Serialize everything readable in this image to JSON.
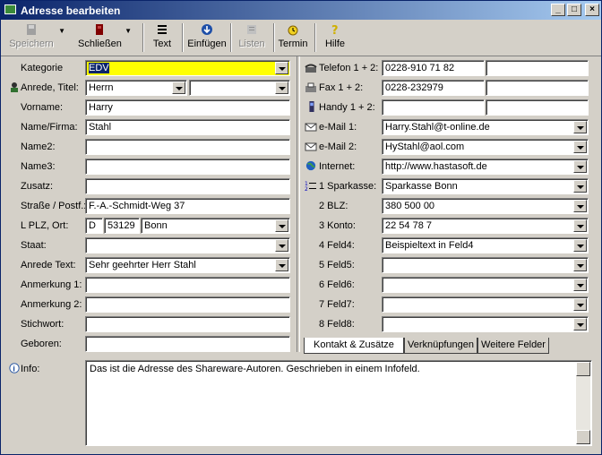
{
  "window": {
    "title": "Adresse bearbeiten",
    "minimize": "_",
    "maximize": "□",
    "close": "×"
  },
  "toolbar": {
    "speichern": "Speichern",
    "schliessen": "Schließen",
    "text": "Text",
    "einfuegen": "Einfügen",
    "listen": "Listen",
    "termin": "Termin",
    "hilfe": "Hilfe"
  },
  "left": {
    "kategorie": {
      "label": "Kategorie",
      "value": "EDV"
    },
    "anrede_titel": {
      "label": "Anrede, Titel:",
      "anrede": "Herrn",
      "titel": ""
    },
    "vorname": {
      "label": "Vorname:",
      "value": "Harry"
    },
    "name": {
      "label": "Name/Firma:",
      "value": "Stahl"
    },
    "name2": {
      "label": "Name2:",
      "value": ""
    },
    "name3": {
      "label": "Name3:",
      "value": ""
    },
    "zusatz": {
      "label": "Zusatz:",
      "value": ""
    },
    "strasse": {
      "label": "Straße / Postf.:",
      "value": "F.-A.-Schmidt-Weg 37"
    },
    "plz_ort": {
      "label": "L PLZ, Ort:",
      "land": "D",
      "plz": "53129",
      "ort": "Bonn"
    },
    "staat": {
      "label": "Staat:",
      "value": ""
    },
    "anrede_text": {
      "label": "Anrede Text:",
      "value": "Sehr geehrter Herr Stahl"
    },
    "anmerkung1": {
      "label": "Anmerkung 1:",
      "value": ""
    },
    "anmerkung2": {
      "label": "Anmerkung 2:",
      "value": ""
    },
    "stichwort": {
      "label": "Stichwort:",
      "value": ""
    },
    "geboren": {
      "label": "Geboren:",
      "value": ""
    }
  },
  "right": {
    "telefon": {
      "label": "Telefon 1 + 2:",
      "value1": "0228-910 71 82",
      "value2": ""
    },
    "fax": {
      "label": "Fax 1 + 2:",
      "value1": "0228-232979",
      "value2": ""
    },
    "handy": {
      "label": "Handy 1 + 2:",
      "value1": "",
      "value2": ""
    },
    "email1": {
      "label": "e-Mail 1:",
      "value": "Harry.Stahl@t-online.de"
    },
    "email2": {
      "label": "e-Mail 2:",
      "value": "HyStahl@aol.com"
    },
    "internet": {
      "label": "Internet:",
      "value": "http://www.hastasoft.de"
    },
    "sparkasse": {
      "label": "1 Sparkasse:",
      "value": "Sparkasse Bonn"
    },
    "blz": {
      "label": "2 BLZ:",
      "value": "380 500 00"
    },
    "konto": {
      "label": "3 Konto:",
      "value": "22 54 78 7"
    },
    "feld4": {
      "label": "4 Feld4:",
      "value": "Beispieltext in Feld4"
    },
    "feld5": {
      "label": "5 Feld5:",
      "value": ""
    },
    "feld6": {
      "label": "6 Feld6:",
      "value": ""
    },
    "feld7": {
      "label": "7 Feld7:",
      "value": ""
    },
    "feld8": {
      "label": "8 Feld8:",
      "value": ""
    }
  },
  "tabs": [
    "Kontakt & Zusätze",
    "Verknüpfungen",
    "Weitere Felder"
  ],
  "info": {
    "label": "Info:",
    "value": "Das ist die Adresse des Shareware-Autoren. Geschrieben in einem Infofeld."
  },
  "colors": {
    "titlebar": "#0a246a",
    "highlight": "#ffff00",
    "face": "#d4d0c8"
  }
}
